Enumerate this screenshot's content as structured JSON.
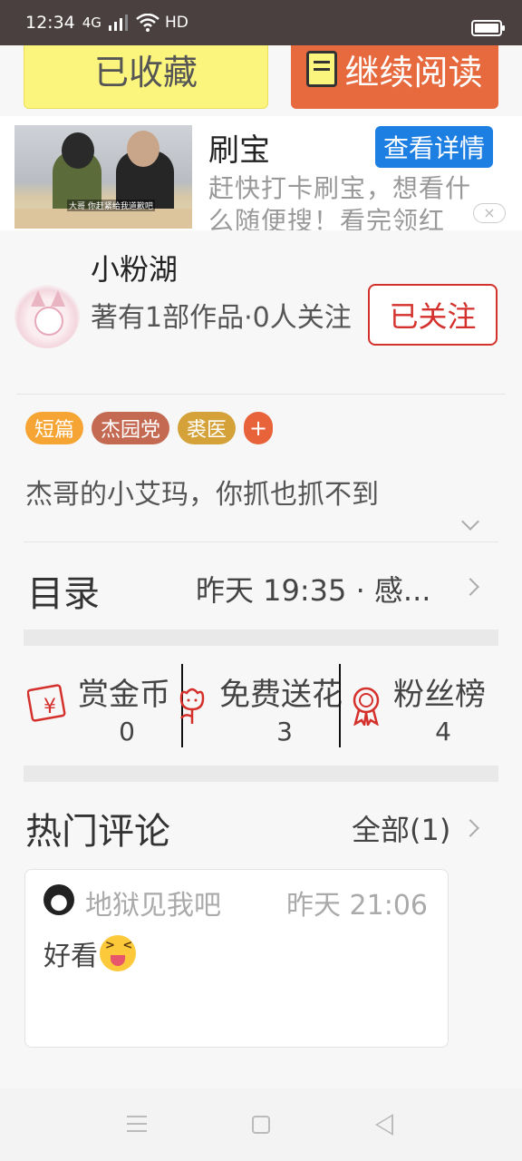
{
  "status_bar": {
    "time": "12:34",
    "network": "4G",
    "hd": "HD"
  },
  "actions": {
    "collect_label": "已收藏",
    "continue_label": "继续阅读"
  },
  "ad": {
    "title": "刷宝",
    "detail_button": "查看详情",
    "description": "赶快打卡刷宝，想看什么随便搜！看完领红",
    "video_subtitle": "大哥 你赶紧给我道歉吧",
    "close_symbol": "×"
  },
  "author": {
    "name": "小粉湖",
    "meta": "著有1部作品·0人关注",
    "follow_label": "已关注"
  },
  "tags": [
    {
      "label": "短篇",
      "color": "#f6a535"
    },
    {
      "label": "杰园党",
      "color": "#c46a52"
    },
    {
      "label": "裘医",
      "color": "#d4a239"
    }
  ],
  "tag_add": "+",
  "intro": "杰哥的小艾玛，你抓也抓不到",
  "catalog": {
    "label": "目录",
    "latest": "昨天 19:35 · 感..."
  },
  "stats": [
    {
      "label": "赏金币",
      "value": "0",
      "icon": "red-envelope-icon"
    },
    {
      "label": "免费送花",
      "value": "3",
      "icon": "flower-icon"
    },
    {
      "label": "粉丝榜",
      "value": "4",
      "icon": "medal-icon"
    }
  ],
  "comments": {
    "title": "热门评论",
    "all_label": "全部(1)",
    "items": [
      {
        "user": "地狱见我吧",
        "time": "昨天 21:06",
        "text": "好看"
      }
    ]
  },
  "colors": {
    "accent_red": "#d4302c",
    "collect_yellow": "#fbf57e",
    "continue_orange": "#e7693e",
    "ad_blue": "#1e7fe3"
  }
}
